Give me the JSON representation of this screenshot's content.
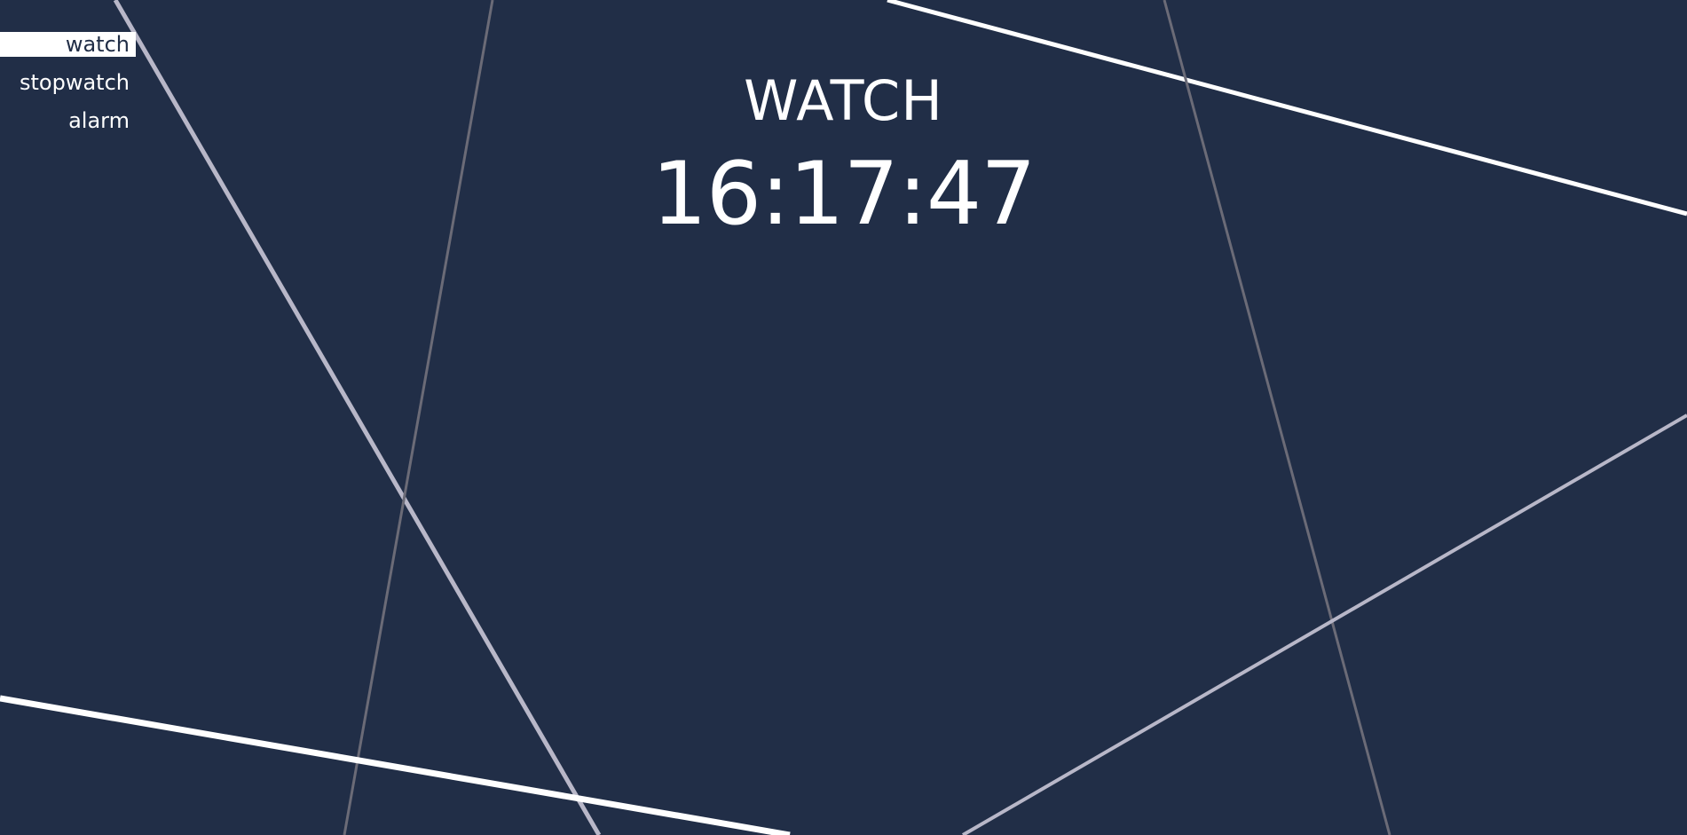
{
  "nav": {
    "items": [
      {
        "label": "watch",
        "active": true
      },
      {
        "label": "stopwatch",
        "active": false
      },
      {
        "label": "alarm",
        "active": false
      }
    ]
  },
  "main": {
    "title": "WATCH",
    "time": "16:17:47"
  },
  "colors": {
    "background": "#212e47",
    "text": "#ffffff",
    "line_bright": "#ffffff",
    "line_light": "#b8b7c8",
    "line_dim": "#6b6b77"
  }
}
